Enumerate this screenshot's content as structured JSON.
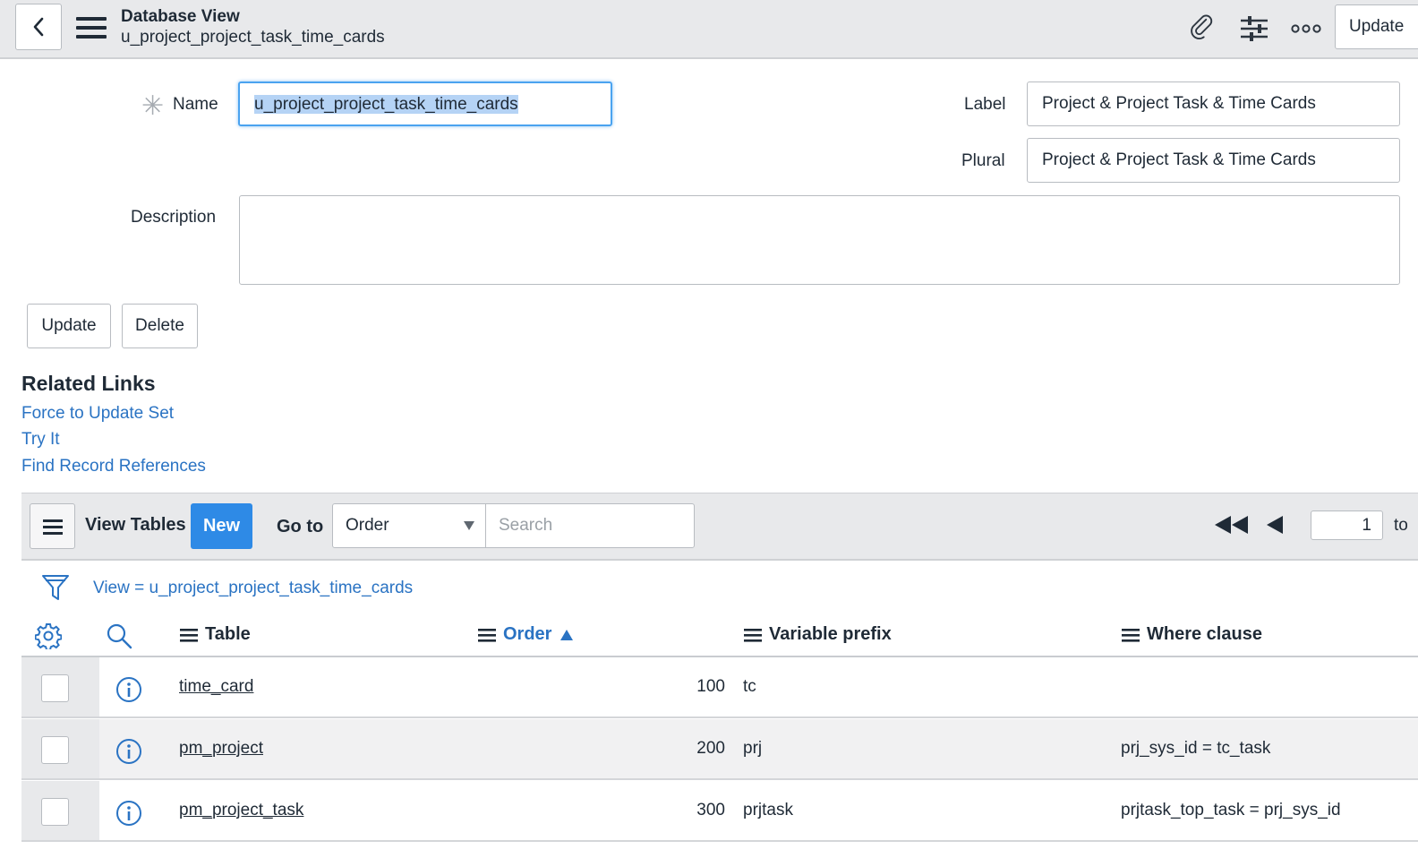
{
  "header": {
    "title": "Database View",
    "subtitle": "u_project_project_task_time_cards",
    "update_label": "Update"
  },
  "form": {
    "name_label": "Name",
    "name_value": "u_project_project_task_time_cards",
    "label_label": "Label",
    "label_value": "Project & Project Task & Time Cards",
    "plural_label": "Plural",
    "plural_value": "Project & Project Task & Time Cards",
    "description_label": "Description",
    "update_button": "Update",
    "delete_button": "Delete"
  },
  "related_links": {
    "title": "Related Links",
    "items": [
      "Force to Update Set",
      "Try It",
      "Find Record References"
    ]
  },
  "list": {
    "title": "View Tables",
    "new_button": "New",
    "goto_label": "Go to",
    "goto_selected": "Order",
    "search_placeholder": "Search",
    "page_value": "1",
    "page_to": "to",
    "filter_text": "View = u_project_project_task_time_cards",
    "columns": [
      "Table",
      "Order",
      "Variable prefix",
      "Where clause"
    ],
    "rows": [
      {
        "table": "time_card",
        "order": "100",
        "prefix": "tc",
        "where": ""
      },
      {
        "table": "pm_project",
        "order": "200",
        "prefix": "prj",
        "where": "prj_sys_id = tc_task"
      },
      {
        "table": "pm_project_task",
        "order": "300",
        "prefix": "prjtask",
        "where": "prjtask_top_task = prj_sys_id"
      }
    ]
  },
  "colors": {
    "accent": "#2e8ae6",
    "link": "#2a73c3",
    "header_bg": "#e8e9eb"
  }
}
